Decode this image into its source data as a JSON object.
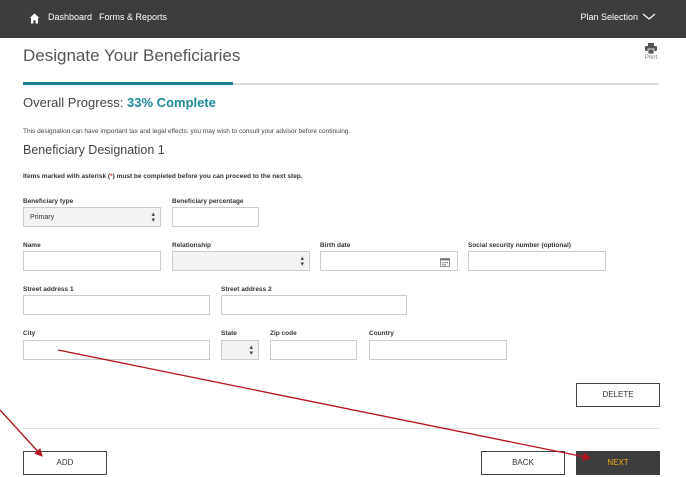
{
  "topbar": {
    "dashboard": "Dashboard",
    "forms_reports": "Forms & Reports",
    "plan_selection": "Plan Selection"
  },
  "page": {
    "title": "Designate Your Beneficiaries",
    "print_label": "Print"
  },
  "progress": {
    "label": "Overall Progress:",
    "percent_text": "33% Complete",
    "fraction": 0.33
  },
  "advice": "This designation can have important tax and legal effects: you may wish to consult your advisor before continuing.",
  "section_title": "Beneficiary Designation 1",
  "required_note": {
    "before": "Items marked with asterisk (",
    "star": "*",
    "after": ") must be completed before you can proceed to the next step."
  },
  "form": {
    "beneficiary_type": {
      "label": "Beneficiary type",
      "value": "Primary"
    },
    "beneficiary_percentage": {
      "label": "Beneficiary percentage",
      "value": ""
    },
    "name": {
      "label": "Name",
      "value": ""
    },
    "relationship": {
      "label": "Relationship",
      "value": ""
    },
    "birth_date": {
      "label": "Birth date",
      "value": ""
    },
    "ssn": {
      "label": "Social security number (optional)",
      "value": ""
    },
    "street1": {
      "label": "Street address 1",
      "value": ""
    },
    "street2": {
      "label": "Street address 2",
      "value": ""
    },
    "city": {
      "label": "City",
      "value": ""
    },
    "state": {
      "label": "State",
      "value": ""
    },
    "zip": {
      "label": "Zip code",
      "value": ""
    },
    "country": {
      "label": "Country",
      "value": ""
    }
  },
  "buttons": {
    "delete": "DELETE",
    "add": "ADD",
    "back": "BACK",
    "next": "NEXT"
  },
  "colors": {
    "topbar": "#3d3d3d",
    "accent": "#1b8a99",
    "next_text": "#f0a81e",
    "annotation_arrow": "#b5121b"
  }
}
